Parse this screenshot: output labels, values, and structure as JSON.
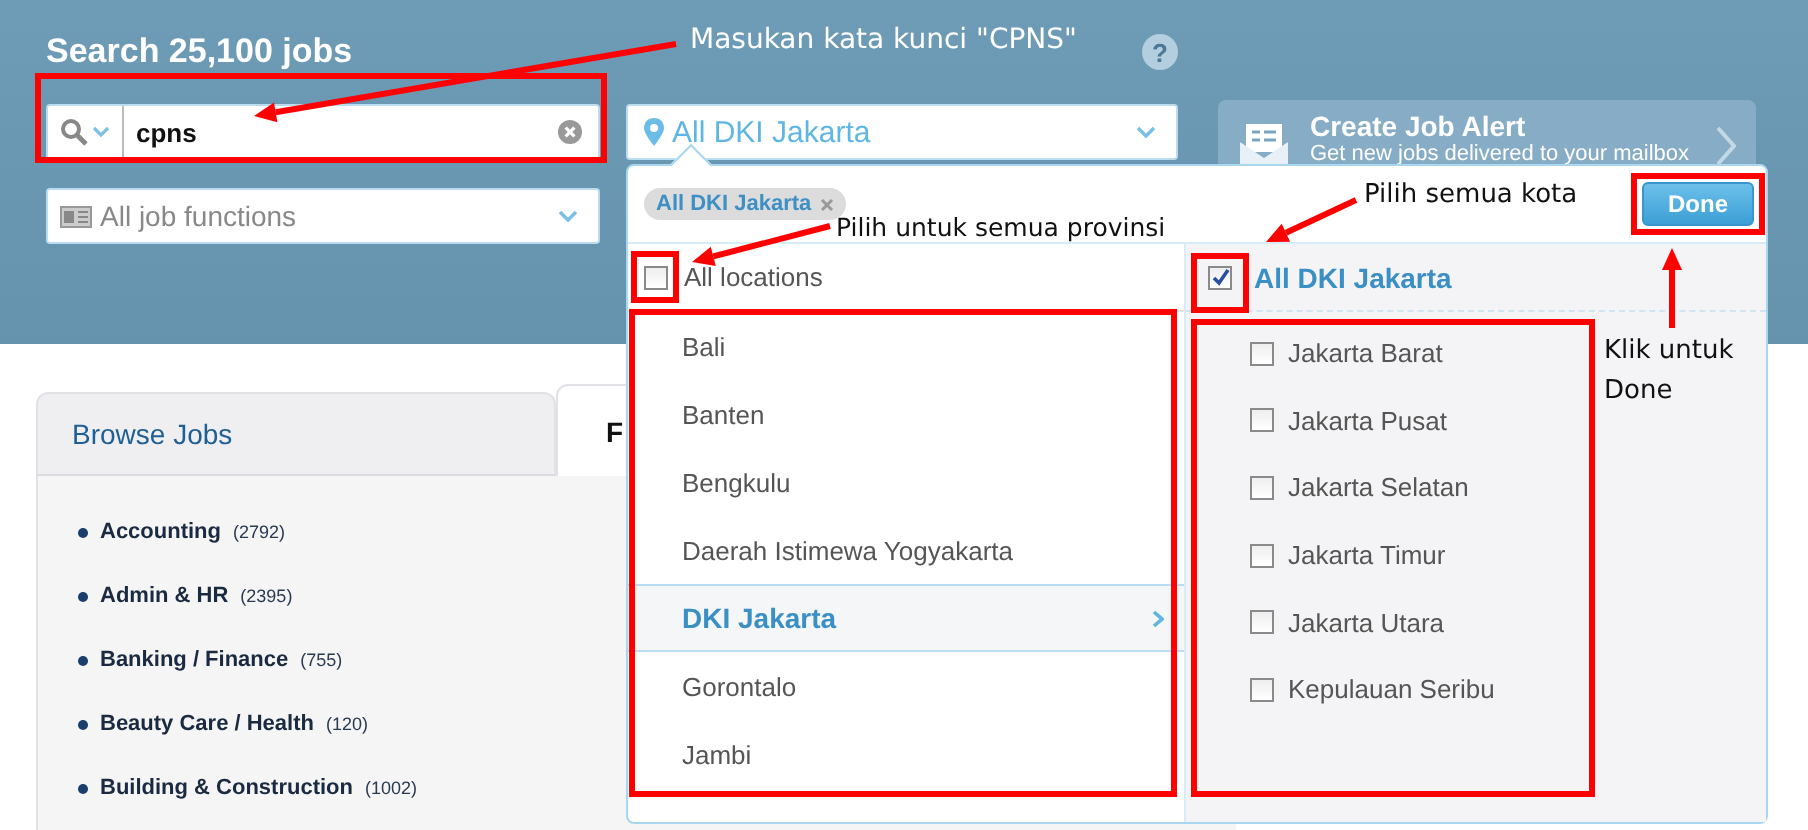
{
  "header": {
    "title": "Search 25,100 jobs",
    "help": "?"
  },
  "keyword_field": {
    "value": "cpns"
  },
  "location_field": {
    "value": "All DKI Jakarta"
  },
  "job_function_field": {
    "placeholder": "All job functions"
  },
  "job_alert": {
    "title": "Create Job Alert",
    "subtitle": "Get new jobs delivered to your mailbox"
  },
  "location_dropdown": {
    "chips": [
      {
        "label": "All DKI Jakarta"
      }
    ],
    "done_button": "Done",
    "all_locations": {
      "label": "All locations",
      "checked": false
    },
    "provinces": [
      {
        "label": "Bali",
        "selected": false
      },
      {
        "label": "Banten",
        "selected": false
      },
      {
        "label": "Bengkulu",
        "selected": false
      },
      {
        "label": "Daerah Istimewa Yogyakarta",
        "selected": false
      },
      {
        "label": "DKI Jakarta",
        "selected": true
      },
      {
        "label": "Gorontalo",
        "selected": false
      },
      {
        "label": "Jambi",
        "selected": false
      }
    ],
    "all_cities": {
      "label": "All DKI Jakarta",
      "checked": true
    },
    "cities": [
      {
        "label": "Jakarta Barat",
        "checked": false
      },
      {
        "label": "Jakarta Pusat",
        "checked": false
      },
      {
        "label": "Jakarta Selatan",
        "checked": false
      },
      {
        "label": "Jakarta Timur",
        "checked": false
      },
      {
        "label": "Jakarta Utara",
        "checked": false
      },
      {
        "label": "Kepulauan Seribu",
        "checked": false
      }
    ]
  },
  "browse": {
    "tabs": [
      {
        "label": "Browse Jobs",
        "selected": false
      },
      {
        "label": "F",
        "selected": true
      }
    ],
    "categories": [
      {
        "name": "Accounting",
        "count": "(2792)"
      },
      {
        "name": "Admin & HR",
        "count": "(2395)"
      },
      {
        "name": "Banking / Finance",
        "count": "(755)"
      },
      {
        "name": "Beauty Care / Health",
        "count": "(120)"
      },
      {
        "name": "Building & Construction",
        "count": "(1002)"
      }
    ]
  },
  "annotations": [
    {
      "text": "Masukan kata kunci \"CPNS\""
    },
    {
      "text": "Pilih untuk semua provinsi"
    },
    {
      "text": "Pilih semua kota"
    },
    {
      "text": "Klik untuk Done"
    }
  ]
}
